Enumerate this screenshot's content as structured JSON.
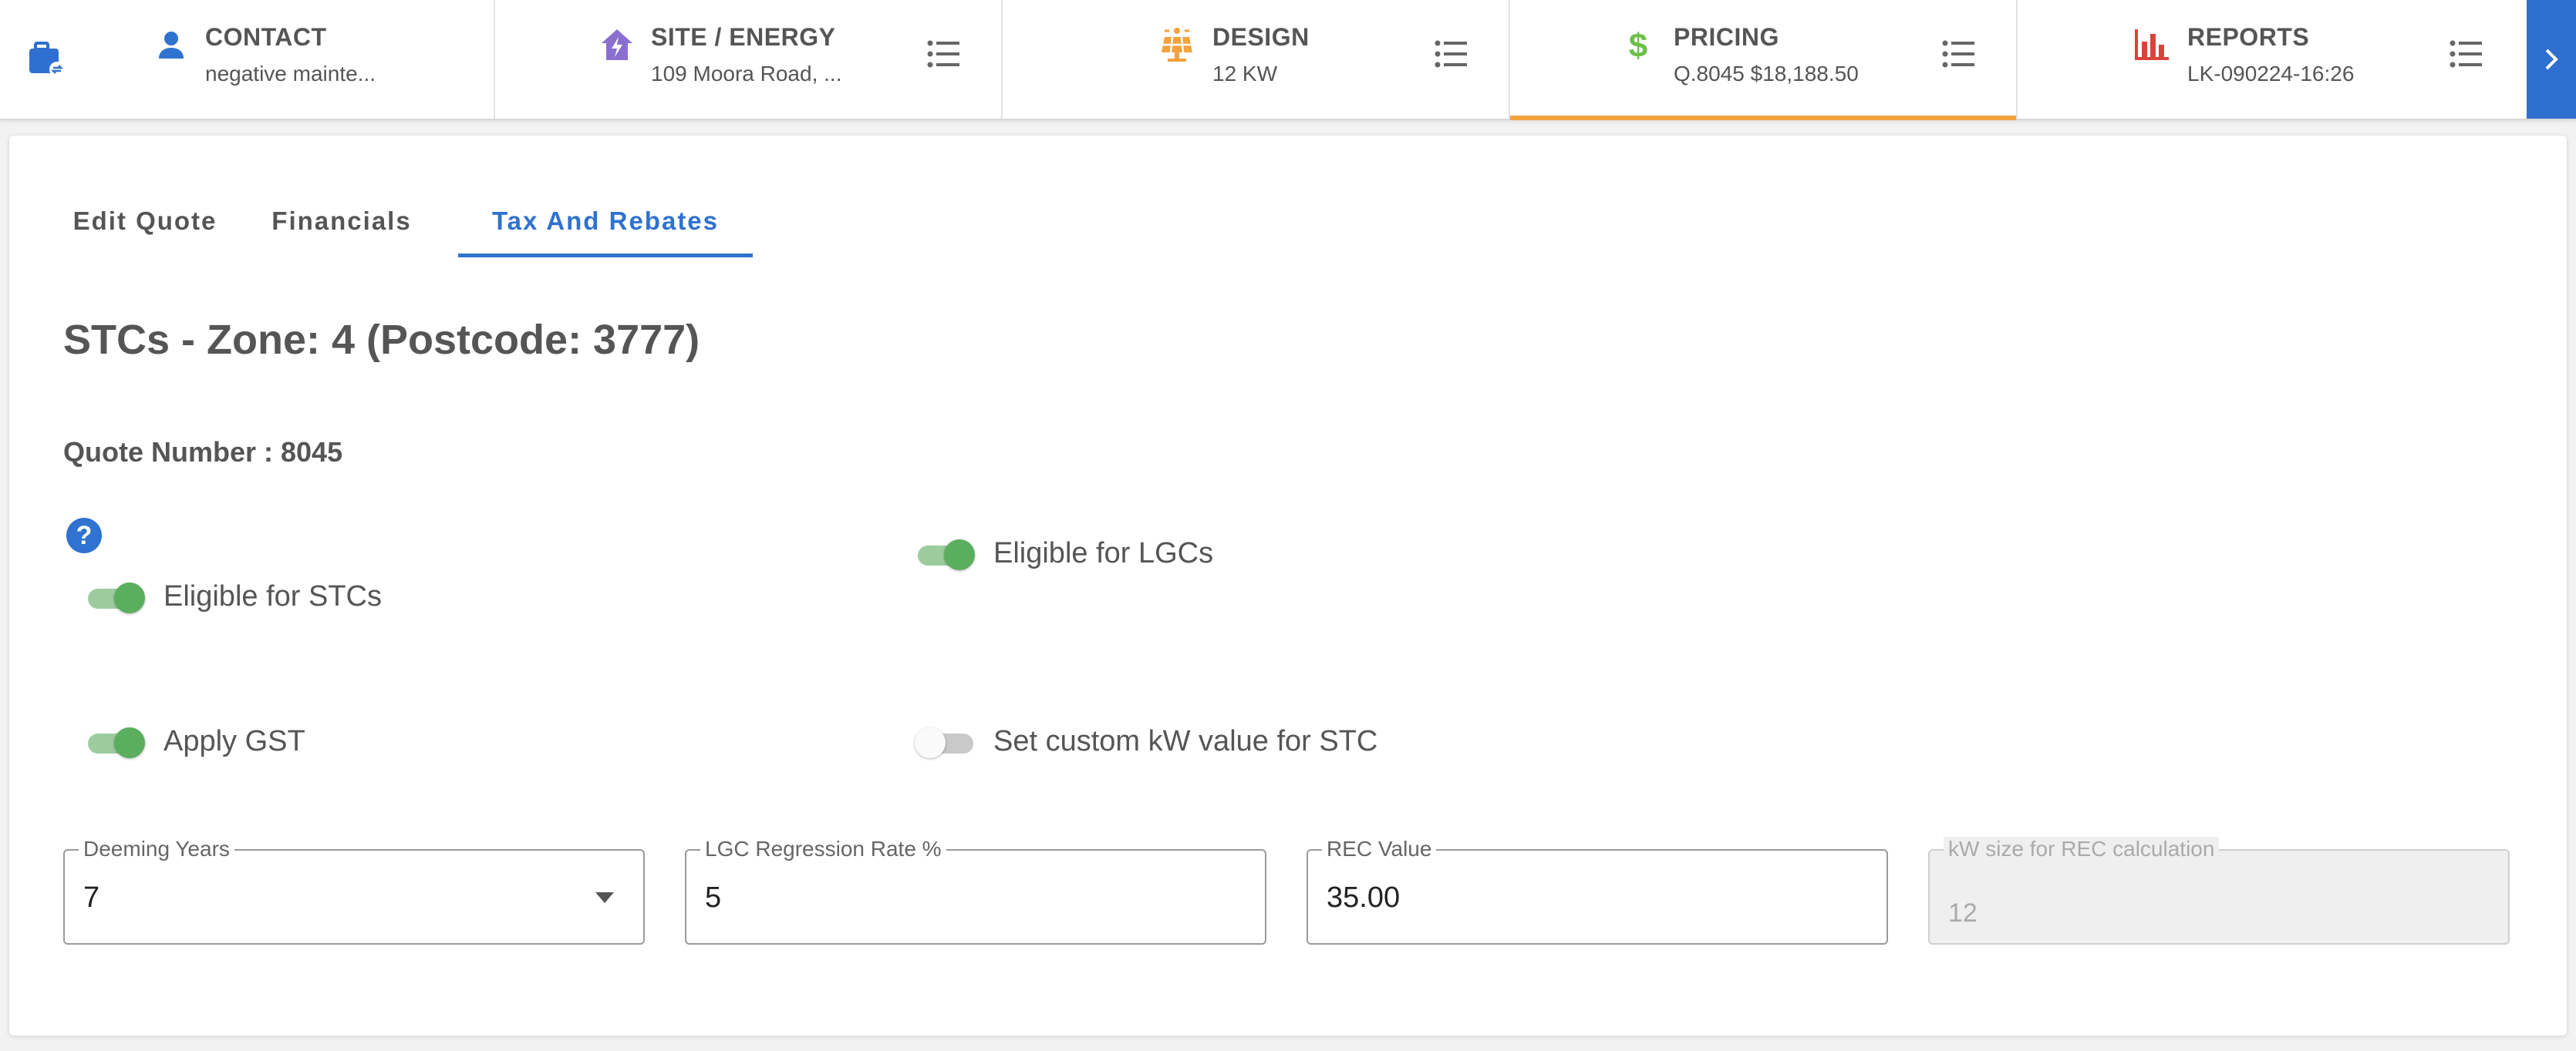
{
  "nav": {
    "steps": [
      {
        "title": "CONTACT",
        "sub": "negative mainte..."
      },
      {
        "title": "SITE / ENERGY",
        "sub": "109 Moora Road, ..."
      },
      {
        "title": "DESIGN",
        "sub": "12 KW"
      },
      {
        "title": "PRICING",
        "sub": "Q.8045 $18,188.50"
      },
      {
        "title": "REPORTS",
        "sub": "LK-090224-16:26"
      }
    ],
    "icons": {
      "home": "briefcase-icon",
      "contact": "person-icon",
      "site": "house-bolt-icon",
      "design": "solar-panel-icon",
      "pricing": "dollar-icon",
      "reports": "bar-chart-icon",
      "menu": "list-icon",
      "next": "chevron-right-icon"
    },
    "active_step": "PRICING",
    "accent_active": "#f3a23c",
    "next_color": "#2f6fd0"
  },
  "tabs": [
    {
      "label": "Edit Quote"
    },
    {
      "label": "Financials"
    },
    {
      "label": "Tax And Rebates"
    }
  ],
  "active_tab": "Tax And Rebates",
  "main": {
    "heading": "STCs - Zone: 4 (Postcode: 3777)",
    "quote_number": "Quote Number : 8045",
    "help_icon": "?",
    "toggles": {
      "stc": {
        "label": "Eligible for STCs",
        "on": true
      },
      "lgc": {
        "label": "Eligible for LGCs",
        "on": true
      },
      "gst": {
        "label": "Apply GST",
        "on": true
      },
      "custom_kw": {
        "label": "Set custom kW value for STC",
        "on": false
      }
    },
    "fields": {
      "deeming_years": {
        "label": "Deeming Years",
        "value": "7"
      },
      "lgc_rate": {
        "label": "LGC Regression Rate %",
        "value": "5"
      },
      "rec_value": {
        "label": "REC Value",
        "value": "35.00"
      },
      "kw_size": {
        "label": "kW size for REC calculation",
        "value": "12",
        "disabled": true
      }
    }
  },
  "colors": {
    "primary": "#2f72d0",
    "toggle_on": "#5aae5e",
    "text": "#555555"
  }
}
